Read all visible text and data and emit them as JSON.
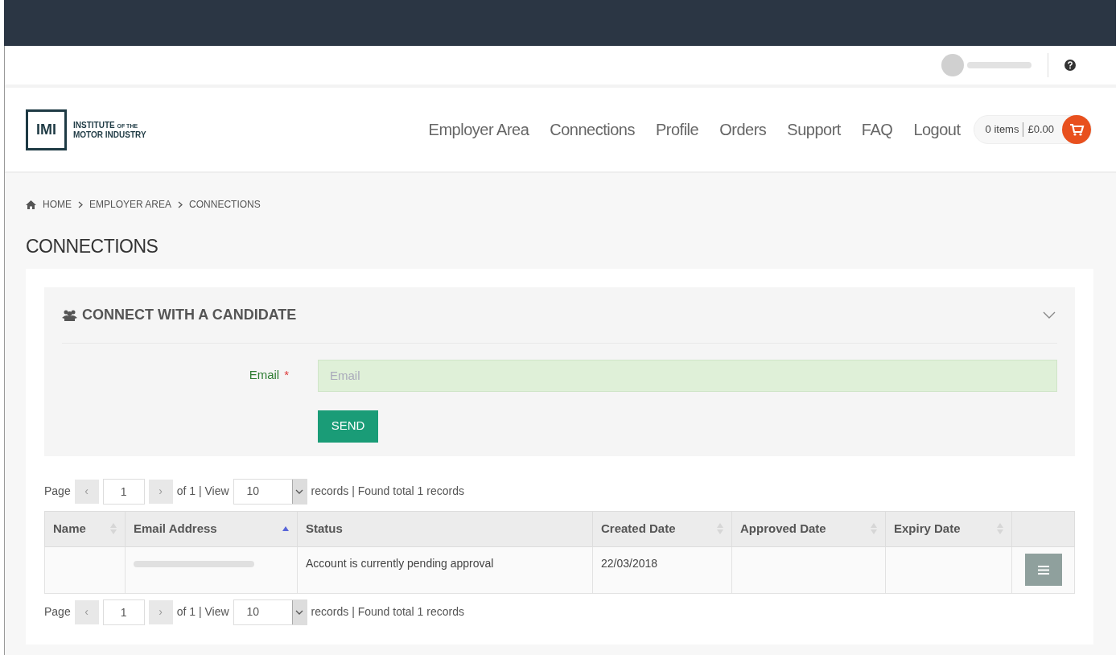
{
  "header": {
    "logo": {
      "mark": "IMI",
      "line1": "INSTITUTE",
      "line1_small": "OF THE",
      "line2": "MOTOR INDUSTRY"
    },
    "nav": [
      {
        "label": "Employer Area"
      },
      {
        "label": "Connections"
      },
      {
        "label": "Profile"
      },
      {
        "label": "Orders"
      },
      {
        "label": "Support"
      },
      {
        "label": "FAQ"
      },
      {
        "label": "Logout"
      }
    ],
    "cart": {
      "items": "0 items",
      "total": "£0.00"
    }
  },
  "breadcrumb": [
    {
      "label": "HOME"
    },
    {
      "label": "EMPLOYER AREA"
    },
    {
      "label": "CONNECTIONS"
    }
  ],
  "page_title": "CONNECTIONS",
  "connect_panel": {
    "title": "CONNECT WITH A CANDIDATE",
    "expanded": true,
    "email_label": "Email",
    "required_mark": "*",
    "email_placeholder": "Email",
    "send_button": "SEND"
  },
  "pager_top": {
    "page_label": "Page",
    "prev": "‹",
    "page": "1",
    "next": "›",
    "of_view": "of 1 | View",
    "view": "10",
    "summary": "records | Found total 1 records"
  },
  "table": {
    "columns": [
      {
        "label": "Name",
        "sortable": true,
        "sorted_ascending": false
      },
      {
        "label": "Email Address",
        "sortable": true,
        "sorted_ascending": true
      },
      {
        "label": "Status",
        "sortable": false
      },
      {
        "label": "Created Date",
        "sortable": true,
        "sorted_ascending": false
      },
      {
        "label": "Approved Date",
        "sortable": true,
        "sorted_ascending": false
      },
      {
        "label": "Expiry Date",
        "sortable": true,
        "sorted_ascending": false
      },
      {
        "sortable": false
      }
    ],
    "rows": [
      {
        "email_redacted": true,
        "status": "Account is currently pending approval",
        "created": "22/03/2018"
      }
    ]
  },
  "pager_bottom": {
    "page_label": "Page",
    "prev": "‹",
    "page": "1",
    "next": "›",
    "of_view": "of 1 | View",
    "view": "10",
    "summary": "records | Found total 1 records"
  }
}
